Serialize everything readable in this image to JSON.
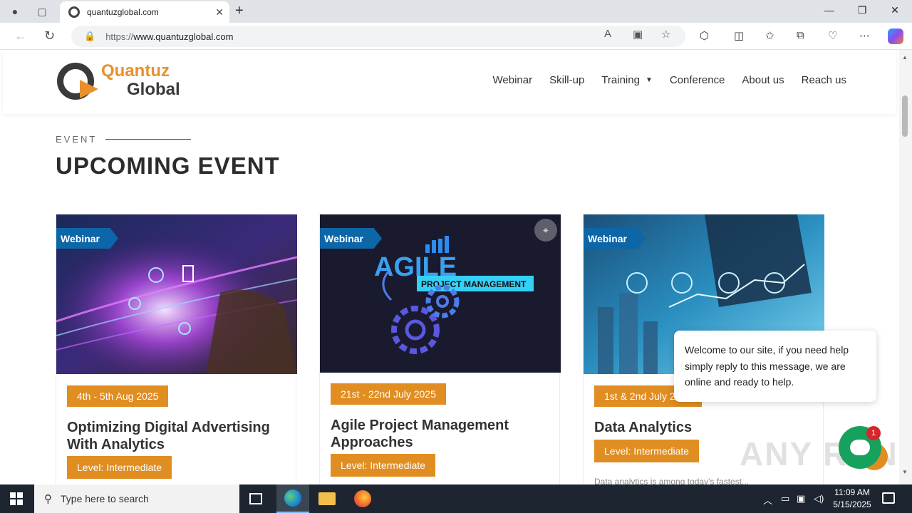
{
  "browser": {
    "tab_title": "quantuzglobal.com",
    "url_prefix": "https://",
    "url_domain": "www.quantuzglobal.com"
  },
  "header": {
    "logo_line1": "Quantuz",
    "logo_line2": "Global",
    "menu": [
      {
        "label": "Webinar"
      },
      {
        "label": "Skill-up"
      },
      {
        "label": "Training"
      },
      {
        "label": "Conference"
      },
      {
        "label": "About us"
      },
      {
        "label": "Reach us"
      }
    ]
  },
  "section": {
    "eyebrow": "EVENT",
    "title": "UPCOMING EVENT"
  },
  "cards": [
    {
      "badge": "Webinar",
      "date": "4th - 5th Aug 2025",
      "title": "Optimizing Digital Advertising With Analytics",
      "level": "Level: Intermediate"
    },
    {
      "badge": "Webinar",
      "image_text_main": "AGILE",
      "image_text_sub": "PROJECT MANAGEMENT",
      "date": "21st - 22nd July 2025",
      "title": "Agile Project Management Approaches",
      "level": "Level: Intermediate"
    },
    {
      "badge": "Webinar",
      "date": "1st & 2nd July 2025",
      "title": "Data Analytics",
      "level": "Level: Intermediate",
      "snippet": "Data analytics is among today's fastest..."
    }
  ],
  "chat": {
    "message": "Welcome to our site, if you need help simply reply to this message, we are online and ready to help.",
    "unread": "1"
  },
  "watermark": "ANY RUN",
  "taskbar": {
    "search_placeholder": "Type here to search",
    "time": "11:09 AM",
    "date": "5/15/2025"
  },
  "colors": {
    "accent_orange": "#e08d22",
    "badge_blue": "#0c66a8",
    "chat_green": "#16a15c"
  }
}
